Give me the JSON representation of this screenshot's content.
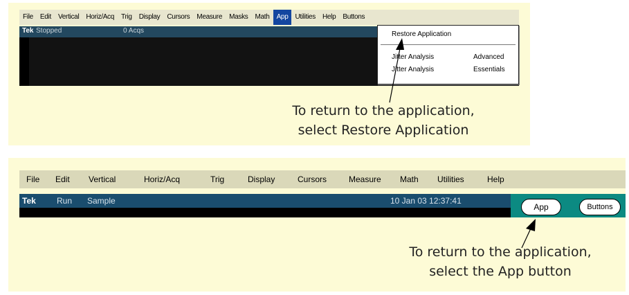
{
  "top_screen": {
    "menu": [
      "File",
      "Edit",
      "Vertical",
      "Horiz/Acq",
      "Trig",
      "Display",
      "Cursors",
      "Measure",
      "Masks",
      "Math",
      "App",
      "Utilities",
      "Help",
      "Buttons"
    ],
    "active_menu": "App",
    "status": {
      "label": "Tek",
      "state": "Stopped",
      "acqs": "0 Acqs"
    },
    "dropdown": {
      "restore": "Restore Application",
      "items": [
        {
          "name": "Jitter Analysis",
          "edition": "Advanced"
        },
        {
          "name": "Jitter Analysis",
          "edition": "Essentials"
        }
      ]
    },
    "callout": {
      "line1": "To return to the application,",
      "line2": "select Restore Application"
    }
  },
  "bottom_screen": {
    "menu": [
      "File",
      "Edit",
      "Vertical",
      "Horiz/Acq",
      "Trig",
      "Display",
      "Cursors",
      "Measure",
      "Math",
      "Utilities",
      "Help"
    ],
    "status": {
      "label": "Tek",
      "state": "Run",
      "mode": "Sample",
      "datetime": "10 Jan 03 12:37:41"
    },
    "app_button": "App",
    "buttons_button": "Buttons",
    "callout": {
      "line1": "To return to the application,",
      "line2": "select the App button"
    }
  },
  "colors": {
    "panel_bg": "#fdfbd6",
    "menu_active": "#1446a0",
    "status_bar": "#1a4d6e",
    "teal_area": "#0c8a82"
  }
}
